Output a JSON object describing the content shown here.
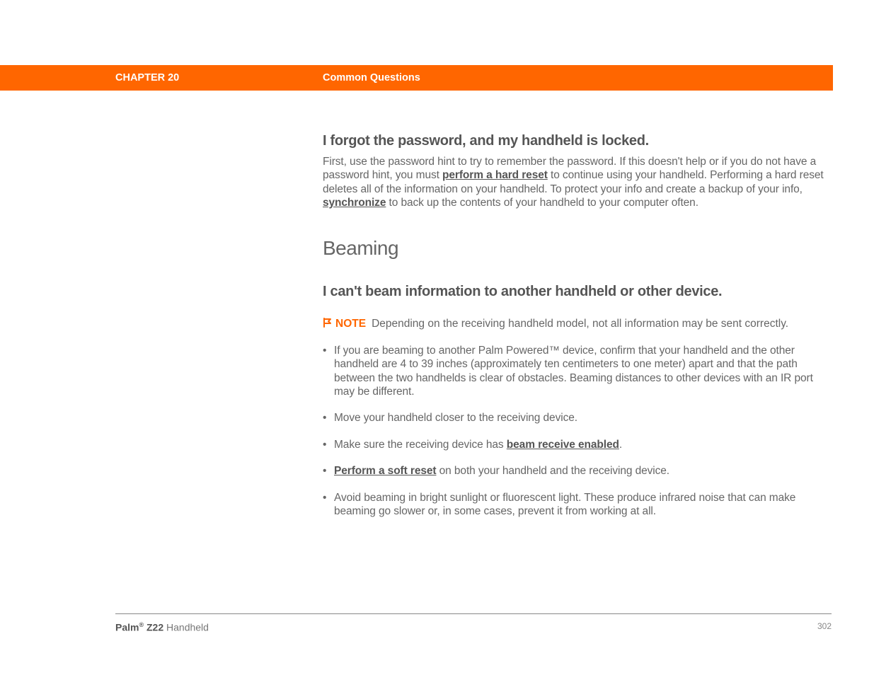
{
  "header": {
    "chapter": "CHAPTER 20",
    "section": "Common Questions"
  },
  "topic1": {
    "heading": "I forgot the password, and my handheld is locked.",
    "p1_a": "First, use the password hint to try to remember the password. If this doesn't help or if you do not have a password hint, you must ",
    "link1": "perform a hard reset",
    "p1_b": " to continue using your handheld. Performing a hard reset deletes all of the information on your handheld. To protect your info and create a backup of your info, ",
    "link2": "synchronize",
    "p1_c": " to back up the contents of your handheld to your computer often."
  },
  "section_heading": "Beaming",
  "topic2": {
    "heading": "I can't beam information to another handheld or other device.",
    "note_label": "NOTE",
    "note_text": "Depending on the receiving handheld model, not all information may be sent correctly.",
    "bullets": {
      "b1": "If you are beaming to another Palm Powered™ device, confirm that your handheld and the other handheld are 4 to 39 inches (approximately ten centimeters to one meter) apart and that the path between the two handhelds is clear of obstacles. Beaming distances to other devices with an IR port may be different.",
      "b2": "Move your handheld closer to the receiving device.",
      "b3_a": "Make sure the receiving device has ",
      "b3_link": "beam receive enabled",
      "b3_b": ".",
      "b4_link": "Perform a soft reset",
      "b4_a": " on both your handheld and the receiving device.",
      "b5": "Avoid beaming in bright sunlight or fluorescent light. These produce infrared noise that can make beaming go slower or, in some cases, prevent it from working at all."
    }
  },
  "footer": {
    "brand": "Palm",
    "reg": "®",
    "model": " Z22",
    "suffix": " Handheld",
    "page": "302"
  }
}
